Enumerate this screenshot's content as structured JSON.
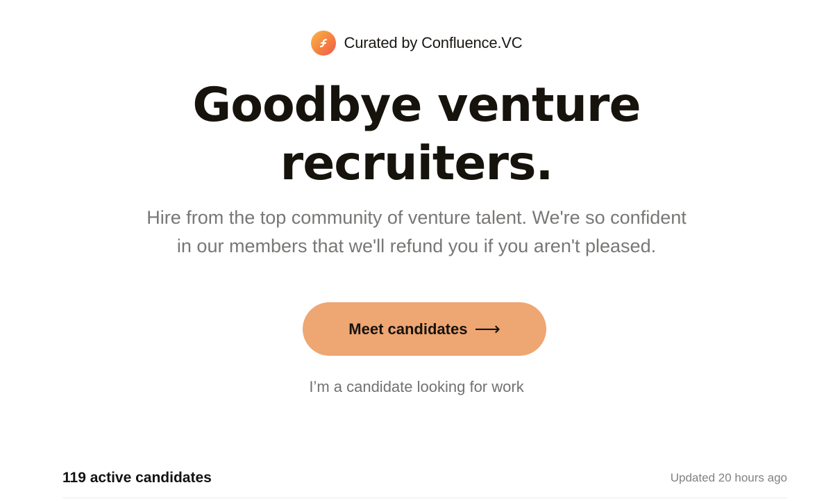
{
  "header": {
    "curated_text": "Curated by Confluence.VC",
    "logo_icon": "confluence-logo-icon",
    "logo_gradient": [
      "#f8b94a",
      "#f5813f",
      "#ee5a52"
    ]
  },
  "hero": {
    "title_line1": "Goodbye venture",
    "title_line2": "recruiters.",
    "subtitle_line1": "Hire from the top community of venture talent. We're so confident",
    "subtitle_line2": "in our members that we'll refund you if you aren't pleased."
  },
  "cta": {
    "label": "Meet candidates",
    "arrow": "⟶",
    "color": "#eea673"
  },
  "candidate_link": {
    "label": "I’m a candidate looking for work"
  },
  "candidates": {
    "count_label": "119 active candidates",
    "updated_label": "Updated 20 hours ago"
  }
}
